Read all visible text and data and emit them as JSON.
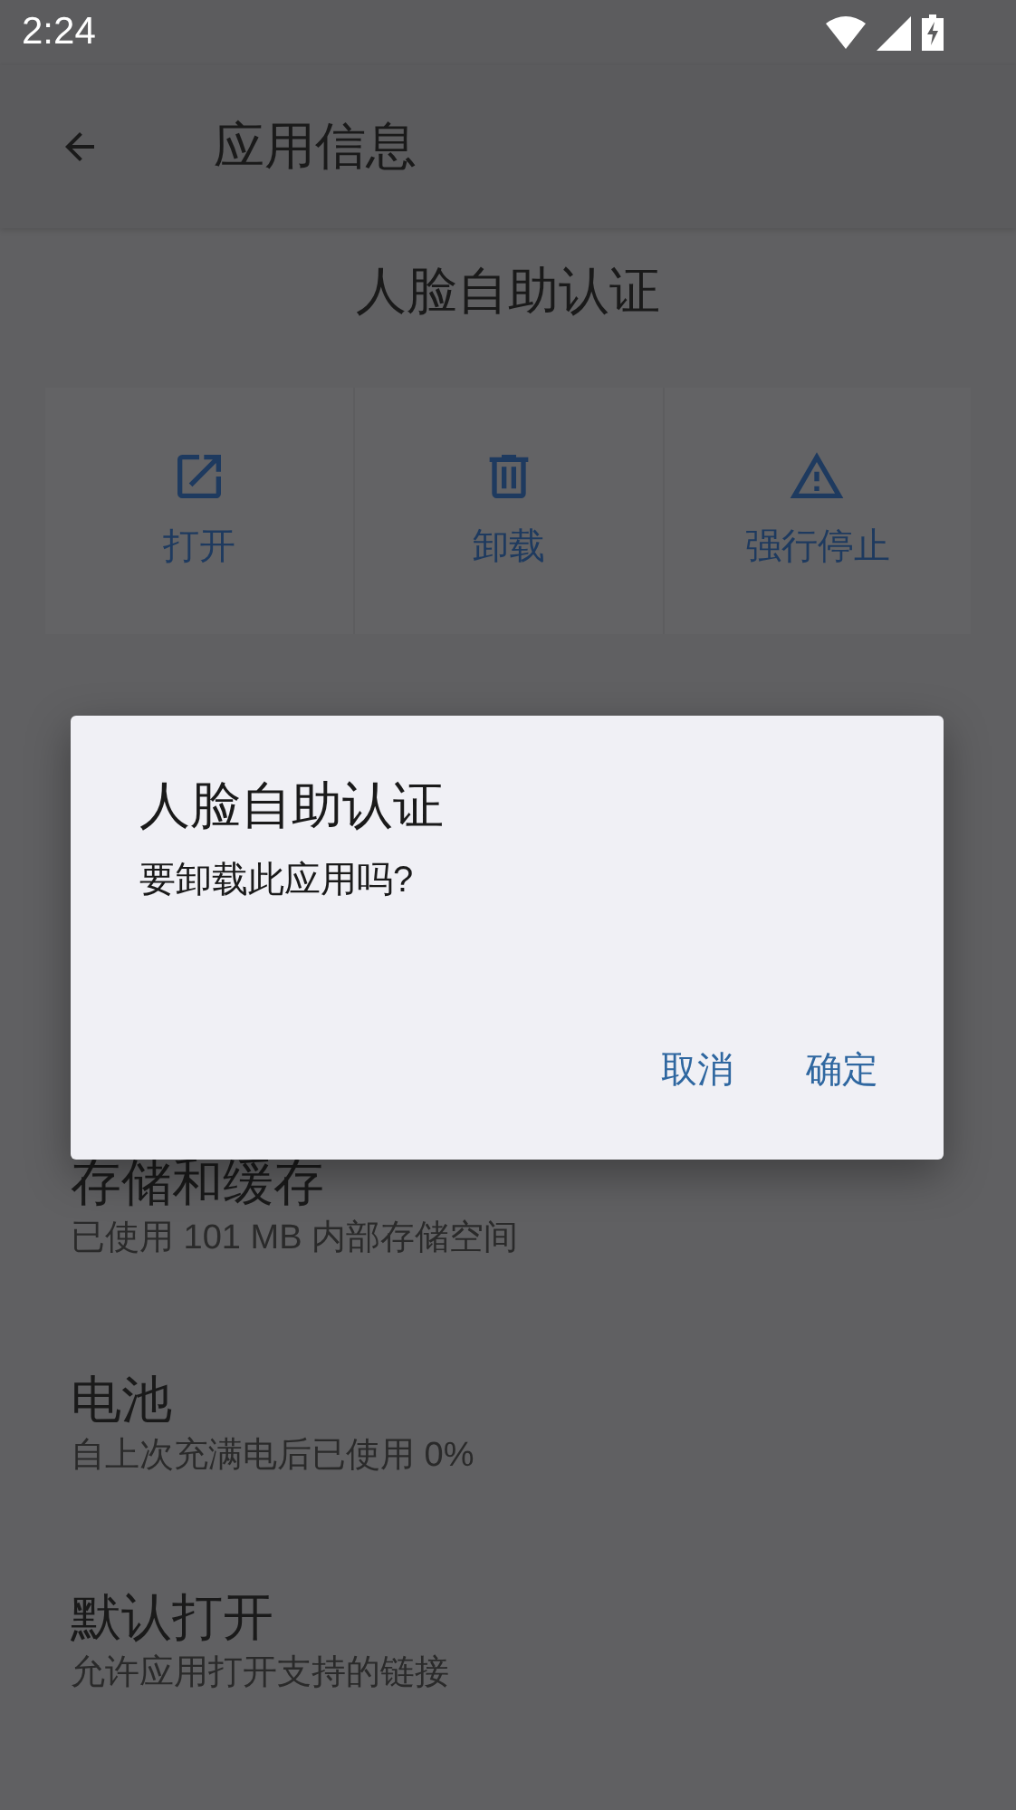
{
  "status_bar": {
    "time": "2:24"
  },
  "app_bar": {
    "title": "应用信息"
  },
  "app_name": "人脸自助认证",
  "actions": [
    {
      "kind": "open",
      "label": "打开"
    },
    {
      "kind": "uninstall",
      "label": "卸载"
    },
    {
      "kind": "force_stop",
      "label": "强行停止"
    }
  ],
  "settings": [
    {
      "title": "存储和缓存",
      "subtitle": "已使用 101 MB 内部存储空间"
    },
    {
      "title": "电池",
      "subtitle": "自上次充满电后已使用 0%"
    },
    {
      "title": "默认打开",
      "subtitle": "允许应用打开支持的链接"
    }
  ],
  "dialog": {
    "title": "人脸自助认证",
    "message": "要卸载此应用吗?",
    "buttons": [
      "取消",
      "确定"
    ]
  }
}
